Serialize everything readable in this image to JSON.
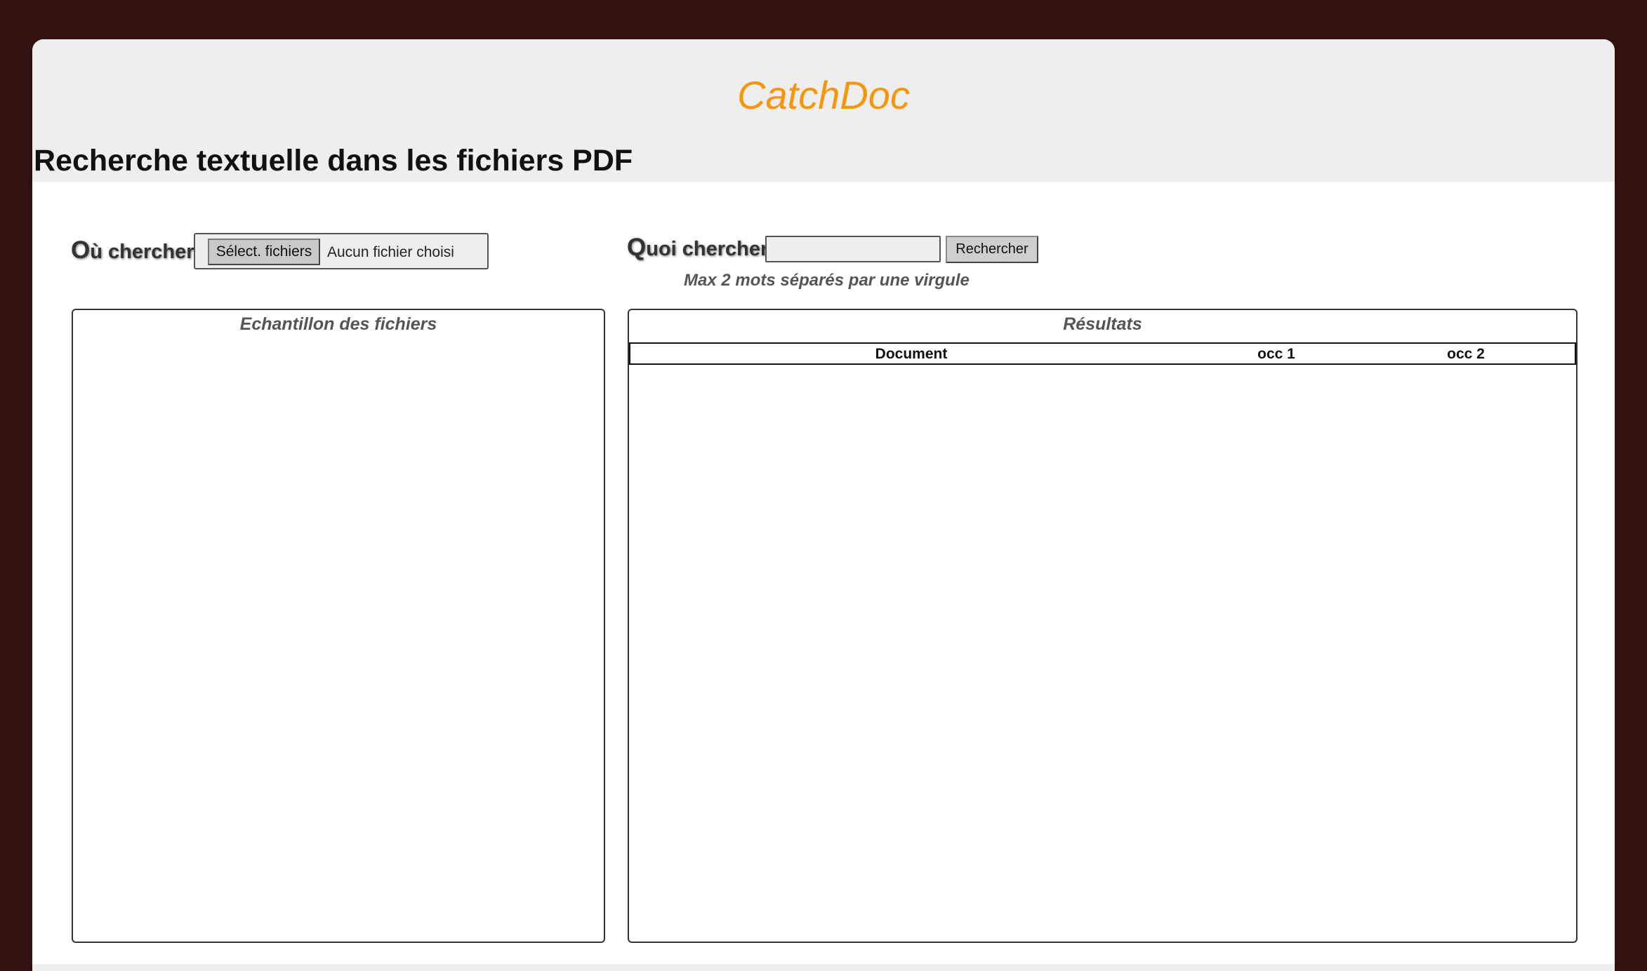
{
  "header": {
    "brand": "CatchDoc",
    "page_title": "Recherche textuelle dans les fichiers PDF"
  },
  "where": {
    "label_initial": "O",
    "label_rest": "ù chercher :",
    "button_label": "Sélect. fichiers",
    "status": "Aucun fichier choisi"
  },
  "what": {
    "label_initial": "Q",
    "label_rest": "uoi chercher :",
    "input_value": "",
    "button_label": "Rechercher",
    "hint": "Max 2 mots séparés par une virgule"
  },
  "files_panel": {
    "title": "Echantillon des fichiers"
  },
  "results_panel": {
    "title": "Résultats",
    "columns": [
      "Document",
      "occ 1",
      "occ 2"
    ]
  },
  "colors": {
    "brand": "#f5960d",
    "background": "#331010",
    "header": "#eeeeee"
  }
}
